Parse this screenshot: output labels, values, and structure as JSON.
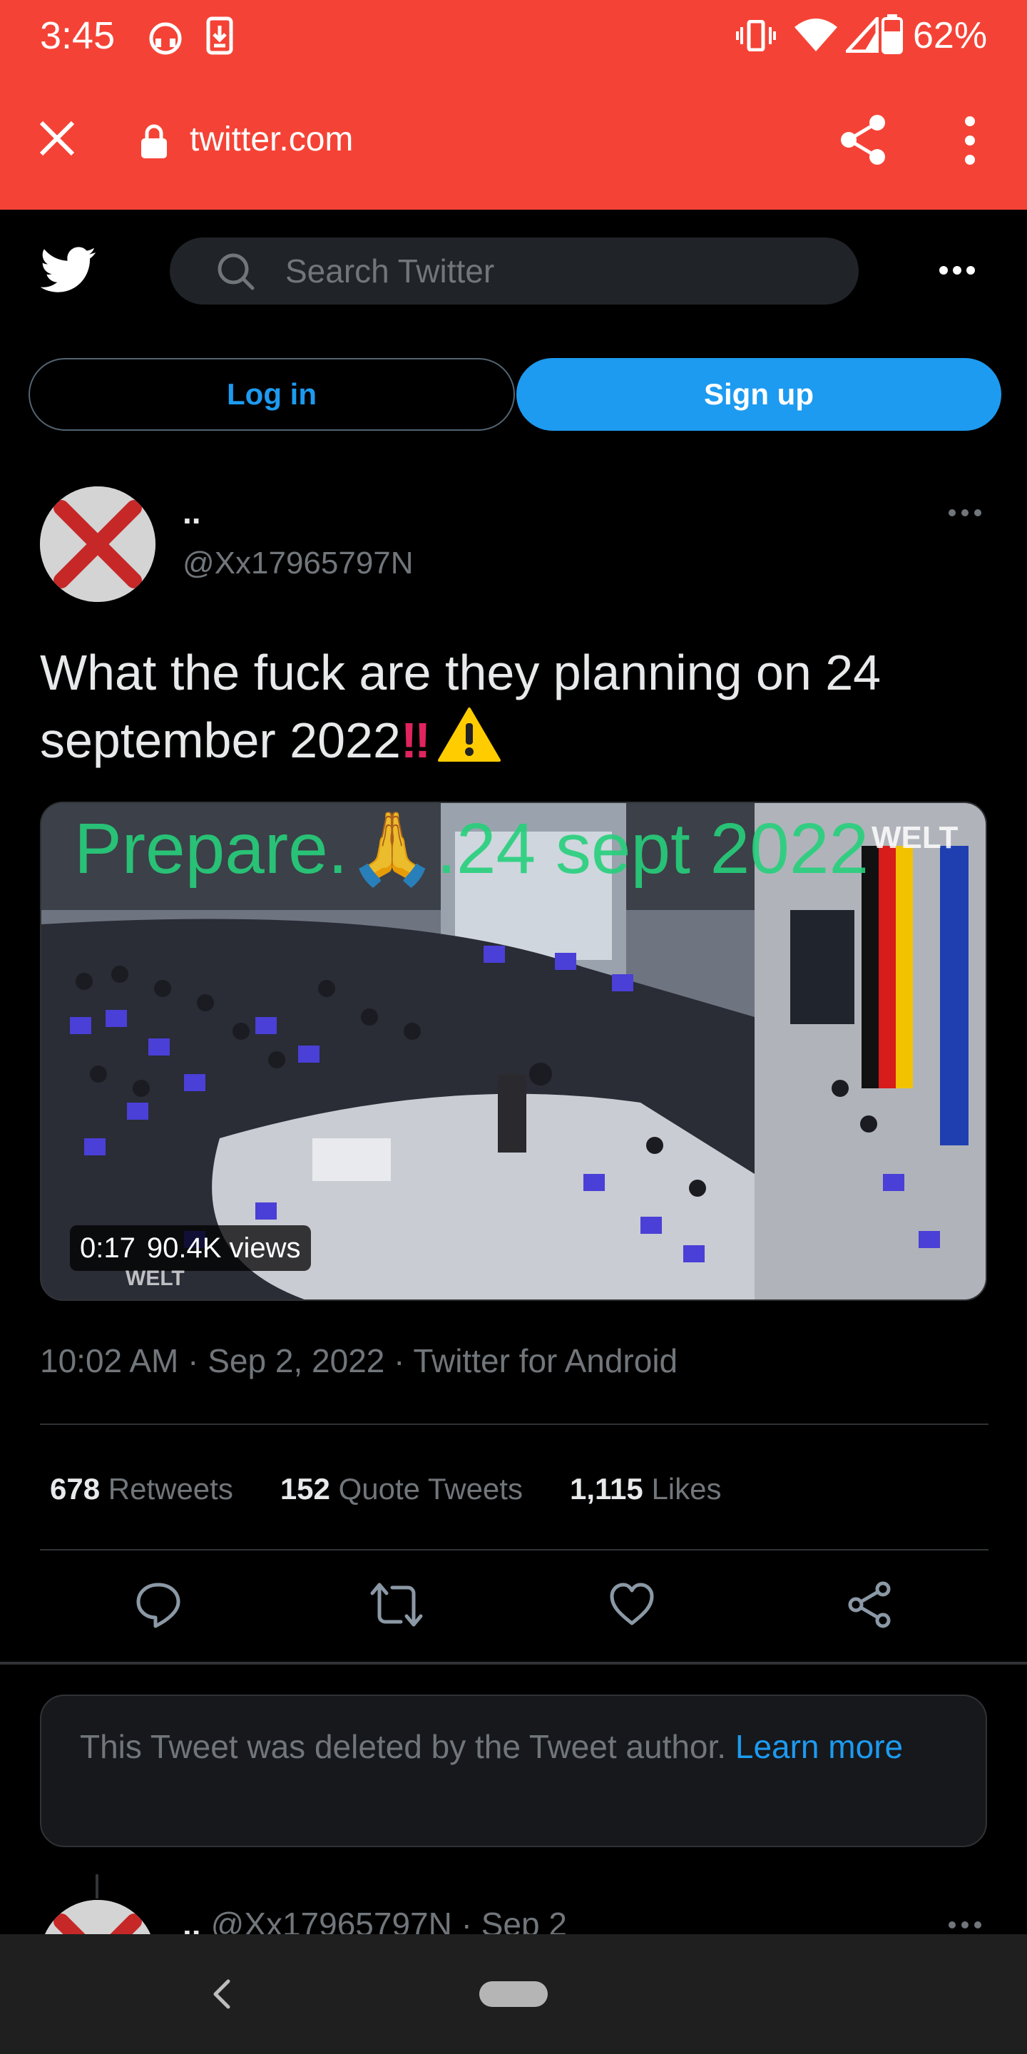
{
  "status_bar": {
    "time": "3:45",
    "battery_percent": "62%",
    "icons": [
      "headset-notification-icon",
      "download-notification-icon",
      "vibrate-icon",
      "wifi-icon",
      "cell-signal-icon",
      "battery-icon"
    ]
  },
  "browser_tab": {
    "url": "twitter.com",
    "icons": [
      "close-icon",
      "lock-icon",
      "share-icon",
      "overflow-menu-icon"
    ],
    "colors": {
      "toolbar": "#f44336"
    }
  },
  "header": {
    "logo": "twitter-bird-icon",
    "search_placeholder": "Search Twitter",
    "more_icon": "more-horizontal-icon"
  },
  "auth": {
    "login_label": "Log in",
    "signup_label": "Sign up",
    "colors": {
      "accent": "#1d9bf0"
    }
  },
  "tweet": {
    "author_name": "..",
    "author_handle": "@Xx17965797N",
    "text": "What the fuck are they planning on 24 september 2022",
    "text_emoji": "‼",
    "video": {
      "overlay_text": "Prepare.🙏.24 sept 2022",
      "watermark": "WELT",
      "duration": "0:17",
      "views": "90.4K views"
    },
    "time": "10:02 AM",
    "date": "Sep 2, 2022",
    "source": "Twitter for Android",
    "stats": {
      "retweets_count": "678",
      "retweets_label": "Retweets",
      "quotes_count": "152",
      "quotes_label": "Quote Tweets",
      "likes_count": "1,115",
      "likes_label": "Likes"
    },
    "actions": [
      "reply-icon",
      "retweet-icon",
      "like-icon",
      "share-icon"
    ]
  },
  "deleted_notice": {
    "text": "This Tweet was deleted by the Tweet author.",
    "link": "Learn more"
  },
  "reply_preview": {
    "author_name": "..",
    "handle": "@Xx17965797N",
    "date": "Sep 2"
  },
  "nav_bar": {
    "icons": [
      "back-icon",
      "home-pill"
    ]
  }
}
